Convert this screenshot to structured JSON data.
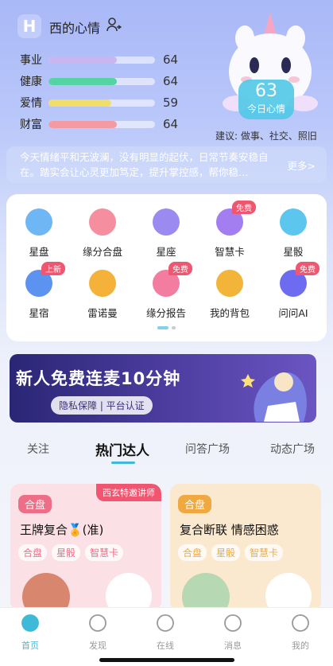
{
  "user": {
    "name": "西的心情"
  },
  "stats": [
    {
      "label": "事业",
      "value": "64",
      "percent": 0.64,
      "color": "#c9b6f1"
    },
    {
      "label": "健康",
      "value": "64",
      "percent": 0.64,
      "color": "#56d3a5"
    },
    {
      "label": "爱情",
      "value": "59",
      "percent": 0.59,
      "color": "#f1de6a"
    },
    {
      "label": "财富",
      "value": "64",
      "percent": 0.64,
      "color": "#f49aa3"
    }
  ],
  "mood": {
    "value": "63",
    "label": "今日心情"
  },
  "suggestion": "建议: 做事、社交、照旧",
  "fortune": {
    "text": "今天情绪平和无波澜，没有明显的起伏，日常节奏安稳自在。踏实会让心灵更加笃定，提升掌控感，帮你稳…",
    "more": "更多>"
  },
  "features": [
    {
      "label": "星盘",
      "badge": "",
      "icon": "star-chart-icon",
      "color": "#6fb6f5"
    },
    {
      "label": "缘分合盘",
      "badge": "",
      "icon": "hearts-icon",
      "color": "#f58fa0"
    },
    {
      "label": "星座",
      "badge": "",
      "icon": "constellation-icon",
      "color": "#9b8af0"
    },
    {
      "label": "智慧卡",
      "badge": "免费",
      "icon": "cards-icon",
      "color": "#a27ef1"
    },
    {
      "label": "星骰",
      "badge": "",
      "icon": "dice-icon",
      "color": "#5cc6ee"
    },
    {
      "label": "星宿",
      "badge": "上新",
      "icon": "moon-clock-icon",
      "color": "#5c93f0"
    },
    {
      "label": "雷诺曼",
      "badge": "",
      "icon": "lenormand-icon",
      "color": "#f4b23b"
    },
    {
      "label": "缘分报告",
      "badge": "免费",
      "icon": "report-icon",
      "color": "#f37da0"
    },
    {
      "label": "我的背包",
      "badge": "",
      "icon": "money-bag-icon",
      "color": "#f3b43a"
    },
    {
      "label": "问问AI",
      "badge": "免费",
      "icon": "robot-icon",
      "color": "#6d6cf0"
    }
  ],
  "banner": {
    "headline": "新人免费连麦10分钟",
    "sub": "隐私保障 | 平台认证"
  },
  "tabs": [
    "关注",
    "热门达人",
    "问答广场",
    "动态广场"
  ],
  "experts": [
    {
      "tag": "合盘",
      "ribbon": "西玄特邀讲师",
      "title": "王牌复合🏅(准)",
      "chips": [
        "合盘",
        "星骰",
        "智慧卡"
      ],
      "bg": "#fbe1e6",
      "tagColor": "#ee6d87"
    },
    {
      "tag": "合盘",
      "ribbon": "",
      "title": "复合断联 情感困惑",
      "chips": [
        "合盘",
        "星骰",
        "智慧卡"
      ],
      "bg": "#fbe9cf",
      "tagColor": "#f0a940"
    }
  ],
  "nav": [
    {
      "label": "首页",
      "icon": "home-icon",
      "active": true
    },
    {
      "label": "发现",
      "icon": "compass-icon",
      "active": false
    },
    {
      "label": "在线",
      "icon": "headphones-icon",
      "active": false
    },
    {
      "label": "消息",
      "icon": "bell-icon",
      "active": false
    },
    {
      "label": "我的",
      "icon": "profile-icon",
      "active": false
    }
  ]
}
